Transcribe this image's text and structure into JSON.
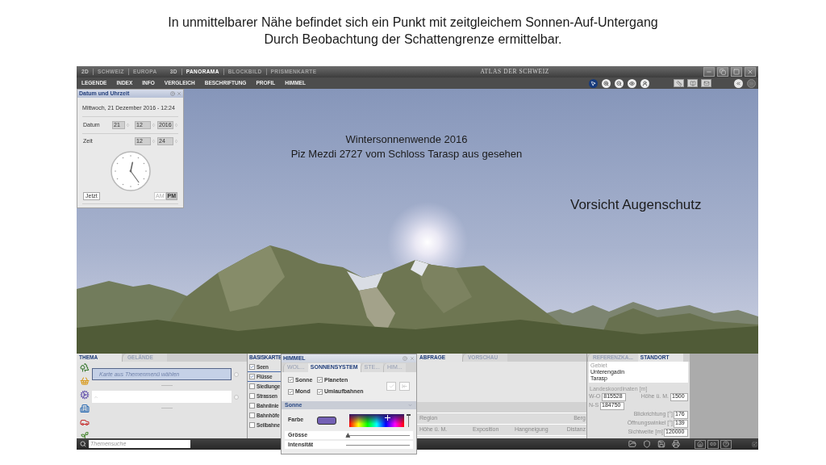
{
  "slide": {
    "title_lines": [
      "In unmittelbarer Nähe befindet sich ein Punkt mit zeitgleichem Sonnen-Auf-Untergang",
      "Durch Beobachtung der Schattengrenze ermittelbar."
    ]
  },
  "title_bar": {
    "view_groups": [
      {
        "label": "2D",
        "items": [
          {
            "label": "SCHWEIZ",
            "selected": false
          },
          {
            "label": "EUROPA",
            "selected": false
          }
        ]
      },
      {
        "label": "3D",
        "items": [
          {
            "label": "PANORAMA",
            "selected": true
          },
          {
            "label": "BLOCKBILD",
            "selected": false
          },
          {
            "label": "PRISMENKARTE",
            "selected": false
          }
        ]
      }
    ],
    "title": "ATLAS DER SCHWEIZ"
  },
  "menu_bar": {
    "items": [
      "LEGENDE",
      "INDEX",
      "INFO",
      "VERGLEICH",
      "BESCHRIFTUNG",
      "PROFIL",
      "HIMMEL"
    ],
    "tools": [
      {
        "selected": true
      },
      {
        "selected": false
      },
      {
        "selected": false
      },
      {
        "selected": false
      },
      {
        "selected": false
      }
    ],
    "history_buttons": [
      {
        "disabled": false
      },
      {
        "disabled": true
      }
    ]
  },
  "date_dialog": {
    "title": "Datum und Uhrzeit",
    "summary": "Mittwoch, 21 Dezember 2016 - 12:24",
    "date_label": "Datum",
    "date_fields": [
      "21",
      "12",
      "2016"
    ],
    "time_label": "Zeit",
    "time_fields": [
      "12",
      "24"
    ],
    "now_button": "Jetzt",
    "periods": [
      {
        "label": "AM",
        "selected": false
      },
      {
        "label": "PM",
        "selected": true
      }
    ]
  },
  "panorama": {
    "caption_lines": [
      "Wintersonnenwende 2016",
      "Piz Mezdi 2727 vom Schloss Tarasp aus gesehen"
    ],
    "note": "Vorsicht Augenschutz"
  },
  "thema_panel": {
    "tabs": [
      {
        "label": "THEMA",
        "selected": true
      },
      {
        "label": "GELÄNDE",
        "selected": false
      }
    ],
    "theme_field": {
      "placeholder": "Karte aus Themenmenü wählen"
    }
  },
  "basiskarte_panel": {
    "title": "BASISKARTE",
    "layers": [
      {
        "label": "Seen",
        "checked": true
      },
      {
        "label": "Flüsse",
        "checked": true
      },
      {
        "label": "Siedlunge",
        "checked": false
      },
      {
        "label": "Strassen",
        "checked": false
      },
      {
        "label": "Bahnlinie",
        "checked": false
      },
      {
        "label": "Bahnhöfe",
        "checked": false
      },
      {
        "label": "Seilbahne",
        "checked": false
      }
    ]
  },
  "himmel_dialog": {
    "title": "HIMMEL",
    "tabs": [
      {
        "label": "WOL...",
        "selected": false
      },
      {
        "label": "SONNENSYSTEM",
        "selected": true
      },
      {
        "label": "STE...",
        "selected": false
      },
      {
        "label": "HIM...",
        "selected": false
      }
    ],
    "options": [
      {
        "label": "Sonne",
        "checked": true
      },
      {
        "label": "Planeten",
        "checked": true
      },
      {
        "label": "Mond",
        "checked": true
      },
      {
        "label": "Umlaufbahnen",
        "checked": true
      }
    ],
    "section": "Sonne",
    "color_label": "Farbe",
    "color": "#7461b5",
    "brightness": {
      "level": 0.95
    },
    "sliders": [
      {
        "label": "Grösse",
        "level": 0.03
      },
      {
        "label": "Intensität"
      }
    ]
  },
  "abfrage_panel": {
    "tabs": [
      {
        "label": "ABFRAGE",
        "selected": true
      },
      {
        "label": "VORSCHAU",
        "selected": false
      }
    ],
    "rows": [
      [
        "Region",
        "",
        "",
        "Berg"
      ],
      [
        "Höhe ü. M.",
        "Exposition",
        "Hangneigung",
        "Distanz"
      ]
    ]
  },
  "standort_panel": {
    "tabs": [
      {
        "label": "REFERENZKA...",
        "selected": false
      },
      {
        "label": "STANDORT",
        "selected": true
      }
    ],
    "area_label": "Gebiet",
    "area_lines": [
      "Unterengadin",
      "Tarasp"
    ],
    "coordinates_label": "Landeskoordinaten [m]",
    "coordinate_rows": [
      [
        {
          "label": "W-O",
          "value": "815528"
        },
        {
          "label": "Höhe ü. M.",
          "value": "1500"
        }
      ],
      [
        {
          "label": "N-S",
          "value": "184750"
        }
      ]
    ],
    "view_fields": [
      {
        "label": "Blickrichtung [°]",
        "value": "176"
      },
      {
        "label": "Öffnungswinkel [°]",
        "value": "139"
      },
      {
        "label": "Sichtweite [m]",
        "value": "120000"
      }
    ]
  },
  "status_bar": {
    "search": {
      "placeholder": "Themensuche"
    }
  }
}
